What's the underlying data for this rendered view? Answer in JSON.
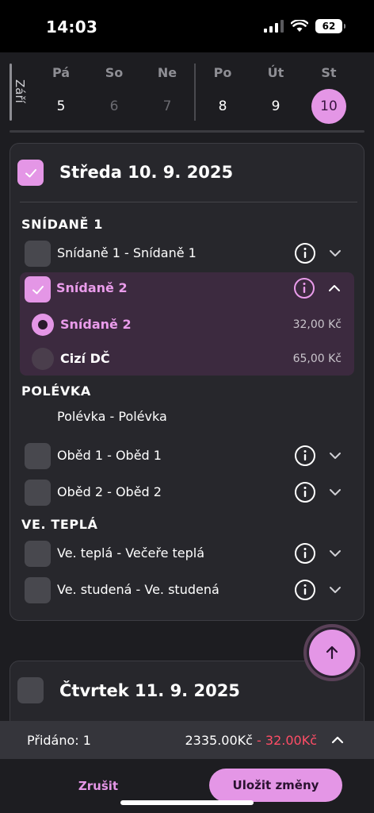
{
  "status": {
    "time": "14:03",
    "battery": "62"
  },
  "week": {
    "month": "Září",
    "days": [
      {
        "name": "Pá",
        "num": "5"
      },
      {
        "name": "So",
        "num": "6"
      },
      {
        "name": "Ne",
        "num": "7"
      },
      {
        "name": "Po",
        "num": "8"
      },
      {
        "name": "Út",
        "num": "9"
      },
      {
        "name": "St",
        "num": "10"
      }
    ],
    "selected_index": 5
  },
  "day_card": {
    "title": "Středa 10. 9. 2025",
    "sections": [
      {
        "title": "SNÍDANĚ 1"
      },
      {
        "title": "POLÉVKA"
      },
      {
        "title": "VE. TEPLÁ"
      }
    ],
    "rows": {
      "snidane1": "Snídaně 1 - Snídaně 1",
      "snidane2": "Snídaně 2",
      "polevka": "Polévka - Polévka",
      "obed1": "Oběd 1 - Oběd 1",
      "obed2": "Oběd 2 - Oběd 2",
      "ve_tepla": "Ve. teplá - Večeře teplá",
      "ve_studena": "Ve. studená - Ve. studená"
    },
    "options": [
      {
        "label": "Snídaně 2",
        "price": "32,00 Kč"
      },
      {
        "label": "Cizí DČ",
        "price": "65,00 Kč"
      }
    ]
  },
  "next_card": {
    "title": "Čtvrtek 11. 9. 2025"
  },
  "summary": {
    "added": "Přidáno: 1",
    "total": "2335.00Kč",
    "delta": "- 32.00Kč"
  },
  "actions": {
    "cancel": "Zrušit",
    "save": "Uložit změny"
  },
  "colors": {
    "accent": "#e496e6",
    "negative": "#ff4d66",
    "background": "#1d1d21"
  }
}
